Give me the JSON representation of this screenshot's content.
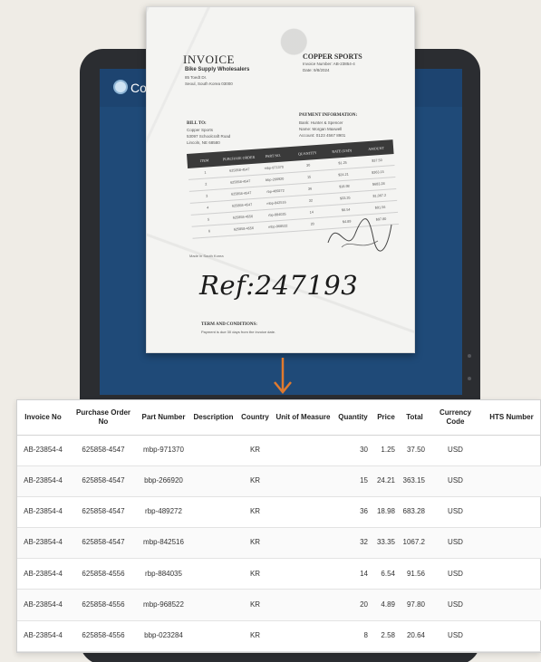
{
  "app": {
    "name": "Co",
    "brand_color": "#1f4a78"
  },
  "invoice_scan": {
    "title": "INVOICE",
    "vendor": {
      "name": "Bike Supply Wholesalers",
      "addr1": "85 Toedt Dr.",
      "addr2": "Seoul, South Korea 03000"
    },
    "customer": {
      "name": "COPPER SPORTS",
      "invoice_number": "Invoice Number: AB-23854-4",
      "date": "Date: 9/8/2024"
    },
    "bill_to": {
      "heading": "BILL TO:",
      "line1": "Copper Sports",
      "line2": "53097 Schoolcraft Road",
      "line3": "Lincoln, NE 68580"
    },
    "payment": {
      "heading": "PAYMENT INFORMATION:",
      "line1": "Bank: Hunter & Spencer",
      "line2": "Name: Morgan Maxwell",
      "line3": "Account: 0123 4567 8901"
    },
    "table_headers": [
      "ITEM",
      "PURCHASE ORDER",
      "PART NO.",
      "QUANTITY",
      "RATE (USD)",
      "AMOUNT"
    ],
    "table_rows": [
      [
        "1",
        "625858-4547",
        "mbp-971370",
        "30",
        "$1.25",
        "$37.50"
      ],
      [
        "2",
        "625858-4547",
        "bbp-266920",
        "15",
        "$24.21",
        "$363.15"
      ],
      [
        "3",
        "625858-4547",
        "rbp-489272",
        "36",
        "$18.98",
        "$683.28"
      ],
      [
        "4",
        "625858-4547",
        "mbp-842516",
        "32",
        "$33.35",
        "$1,067.2"
      ],
      [
        "5",
        "625858-4556",
        "rbp-884035",
        "14",
        "$6.54",
        "$91.56"
      ],
      [
        "6",
        "625858-4556",
        "mbp-968522",
        "20",
        "$4.89",
        "$97.80"
      ]
    ],
    "made_in": "Made in South Korea",
    "handwritten_ref": "Ref:247193",
    "terms_heading": "TERM AND CONDITIONS:",
    "terms_text": "Payment is due 30 days from the invoice date."
  },
  "table": {
    "headers": {
      "invoice_no": "Invoice No",
      "purchase_order_no": "Purchase Order No",
      "part_number": "Part Number",
      "description": "Description",
      "country": "Country",
      "unit_of_measure": "Unit of Measure",
      "quantity": "Quantity",
      "price": "Price",
      "total": "Total",
      "currency_code": "Currency Code",
      "hts_number": "HTS Number"
    },
    "rows": [
      {
        "invoice_no": "AB-23854-4",
        "purchase_order_no": "625858-4547",
        "part_number": "mbp-971370",
        "description": "",
        "country": "KR",
        "unit_of_measure": "",
        "quantity": "30",
        "price": "1.25",
        "total": "37.50",
        "currency_code": "USD",
        "hts_number": ""
      },
      {
        "invoice_no": "AB-23854-4",
        "purchase_order_no": "625858-4547",
        "part_number": "bbp-266920",
        "description": "",
        "country": "KR",
        "unit_of_measure": "",
        "quantity": "15",
        "price": "24.21",
        "total": "363.15",
        "currency_code": "USD",
        "hts_number": ""
      },
      {
        "invoice_no": "AB-23854-4",
        "purchase_order_no": "625858-4547",
        "part_number": "rbp-489272",
        "description": "",
        "country": "KR",
        "unit_of_measure": "",
        "quantity": "36",
        "price": "18.98",
        "total": "683.28",
        "currency_code": "USD",
        "hts_number": ""
      },
      {
        "invoice_no": "AB-23854-4",
        "purchase_order_no": "625858-4547",
        "part_number": "mbp-842516",
        "description": "",
        "country": "KR",
        "unit_of_measure": "",
        "quantity": "32",
        "price": "33.35",
        "total": "1067.2",
        "currency_code": "USD",
        "hts_number": ""
      },
      {
        "invoice_no": "AB-23854-4",
        "purchase_order_no": "625858-4556",
        "part_number": "rbp-884035",
        "description": "",
        "country": "KR",
        "unit_of_measure": "",
        "quantity": "14",
        "price": "6.54",
        "total": "91.56",
        "currency_code": "USD",
        "hts_number": ""
      },
      {
        "invoice_no": "AB-23854-4",
        "purchase_order_no": "625858-4556",
        "part_number": "mbp-968522",
        "description": "",
        "country": "KR",
        "unit_of_measure": "",
        "quantity": "20",
        "price": "4.89",
        "total": "97.80",
        "currency_code": "USD",
        "hts_number": ""
      },
      {
        "invoice_no": "AB-23854-4",
        "purchase_order_no": "625858-4556",
        "part_number": "bbp-023284",
        "description": "",
        "country": "KR",
        "unit_of_measure": "",
        "quantity": "8",
        "price": "2.58",
        "total": "20.64",
        "currency_code": "USD",
        "hts_number": ""
      }
    ]
  },
  "icons": {
    "arrow": "arrow-down-icon",
    "logo": "app-logo-icon"
  },
  "colors": {
    "arrow": "#e07a2e",
    "screen": "#1f4a78",
    "device": "#2b2d31"
  }
}
